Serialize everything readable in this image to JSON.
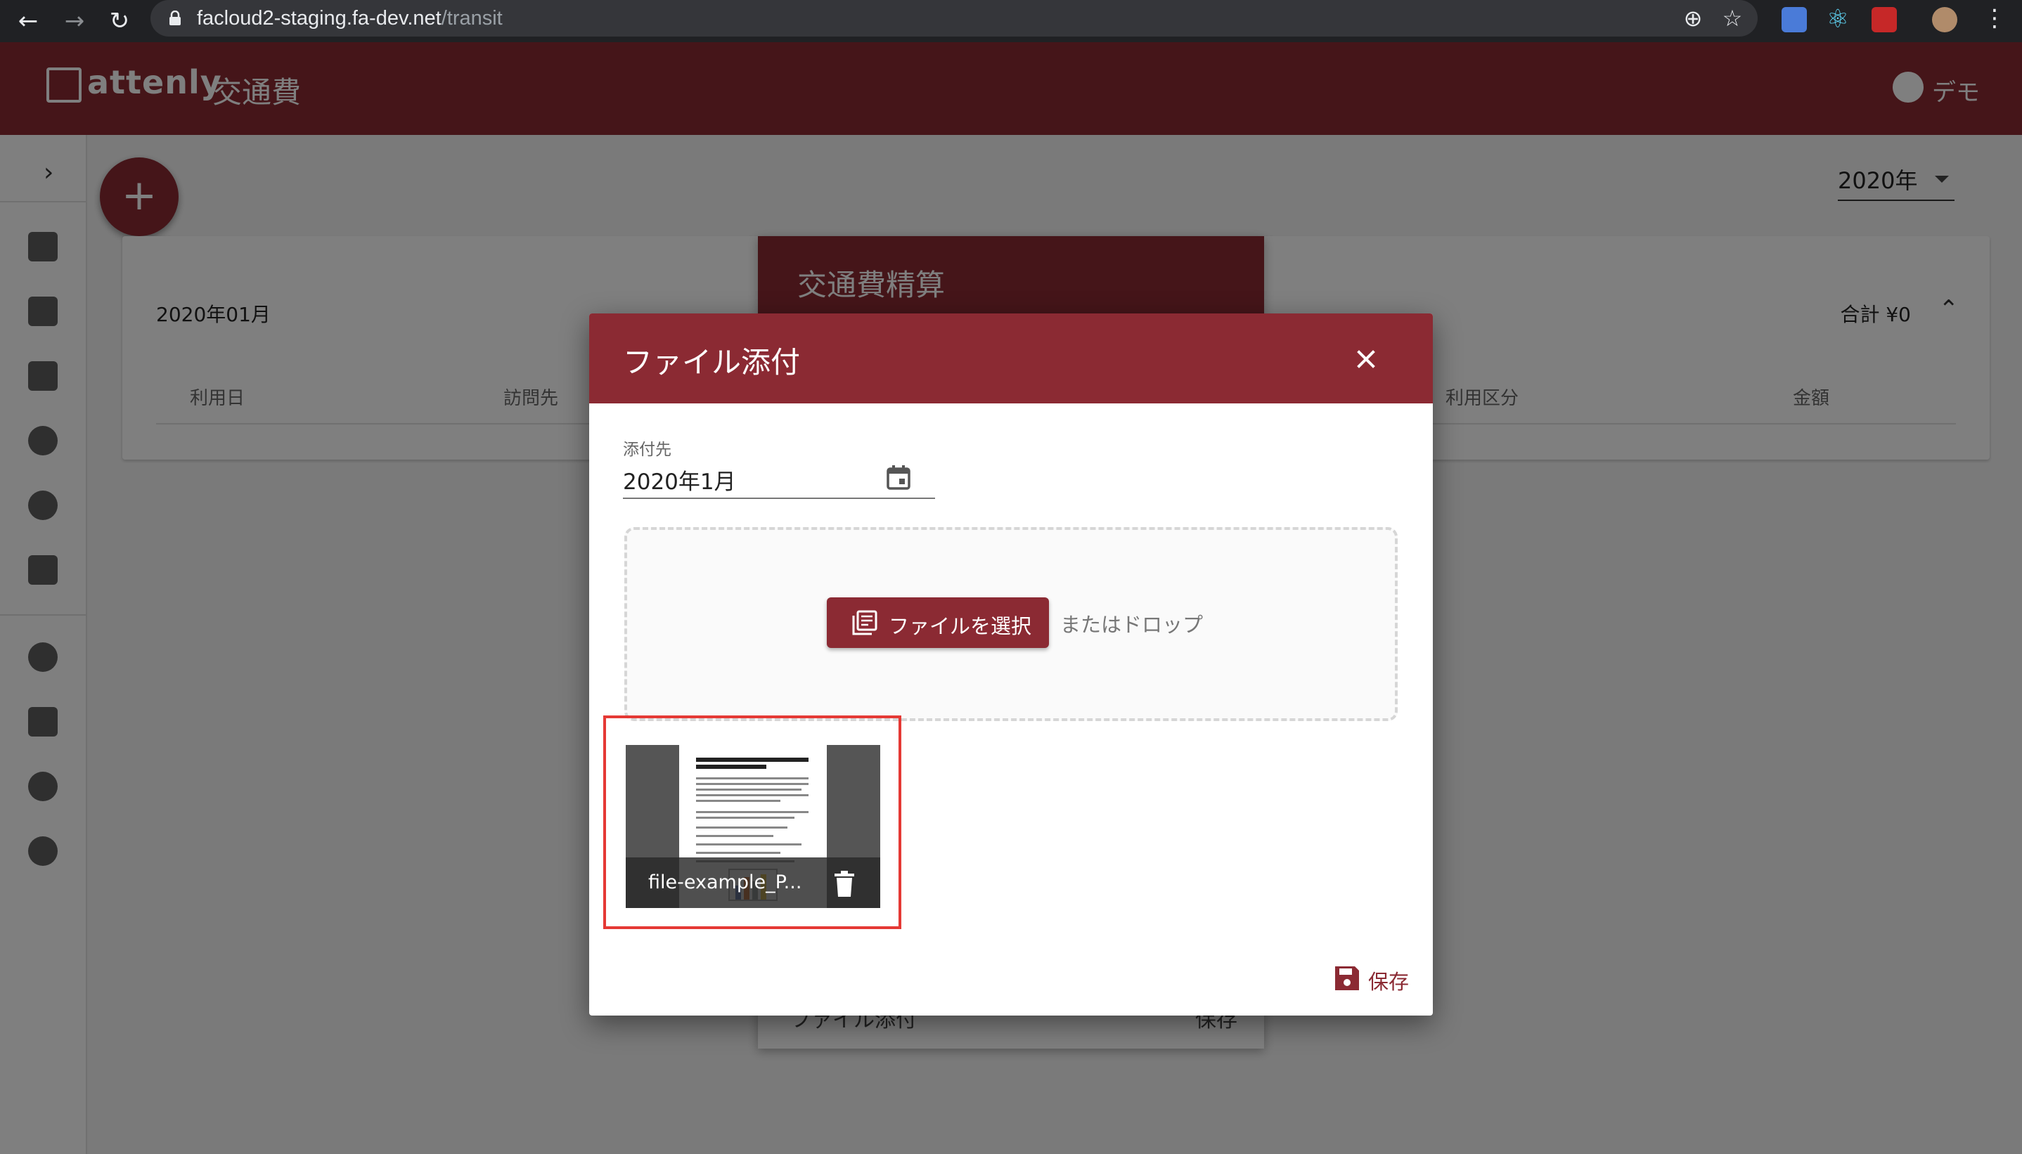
{
  "browser": {
    "url_host": "facloud2-staging.fa-dev.net",
    "url_path": "/transit"
  },
  "app": {
    "logo_text": "attenly",
    "title": "交通費",
    "user_name": "デモ",
    "year_select": "2020年",
    "card": {
      "month": "2020年01月",
      "total": "合計 ¥0",
      "columns": [
        "利用日",
        "訪問先",
        "利用区分",
        "金額"
      ]
    },
    "background_dialog": {
      "title": "交通費精算",
      "attach_label": "ファイル添付",
      "save_label": "保存"
    }
  },
  "modal": {
    "title": "ファイル添付",
    "attach_to_label": "添付先",
    "attach_to_value": "2020年1月",
    "select_button": "ファイルを選択",
    "drop_text": "またはドロップ",
    "file_name": "file-example_P...",
    "save_label": "保存"
  },
  "colors": {
    "primary": "#8b2a33",
    "highlight": "#e53935"
  }
}
